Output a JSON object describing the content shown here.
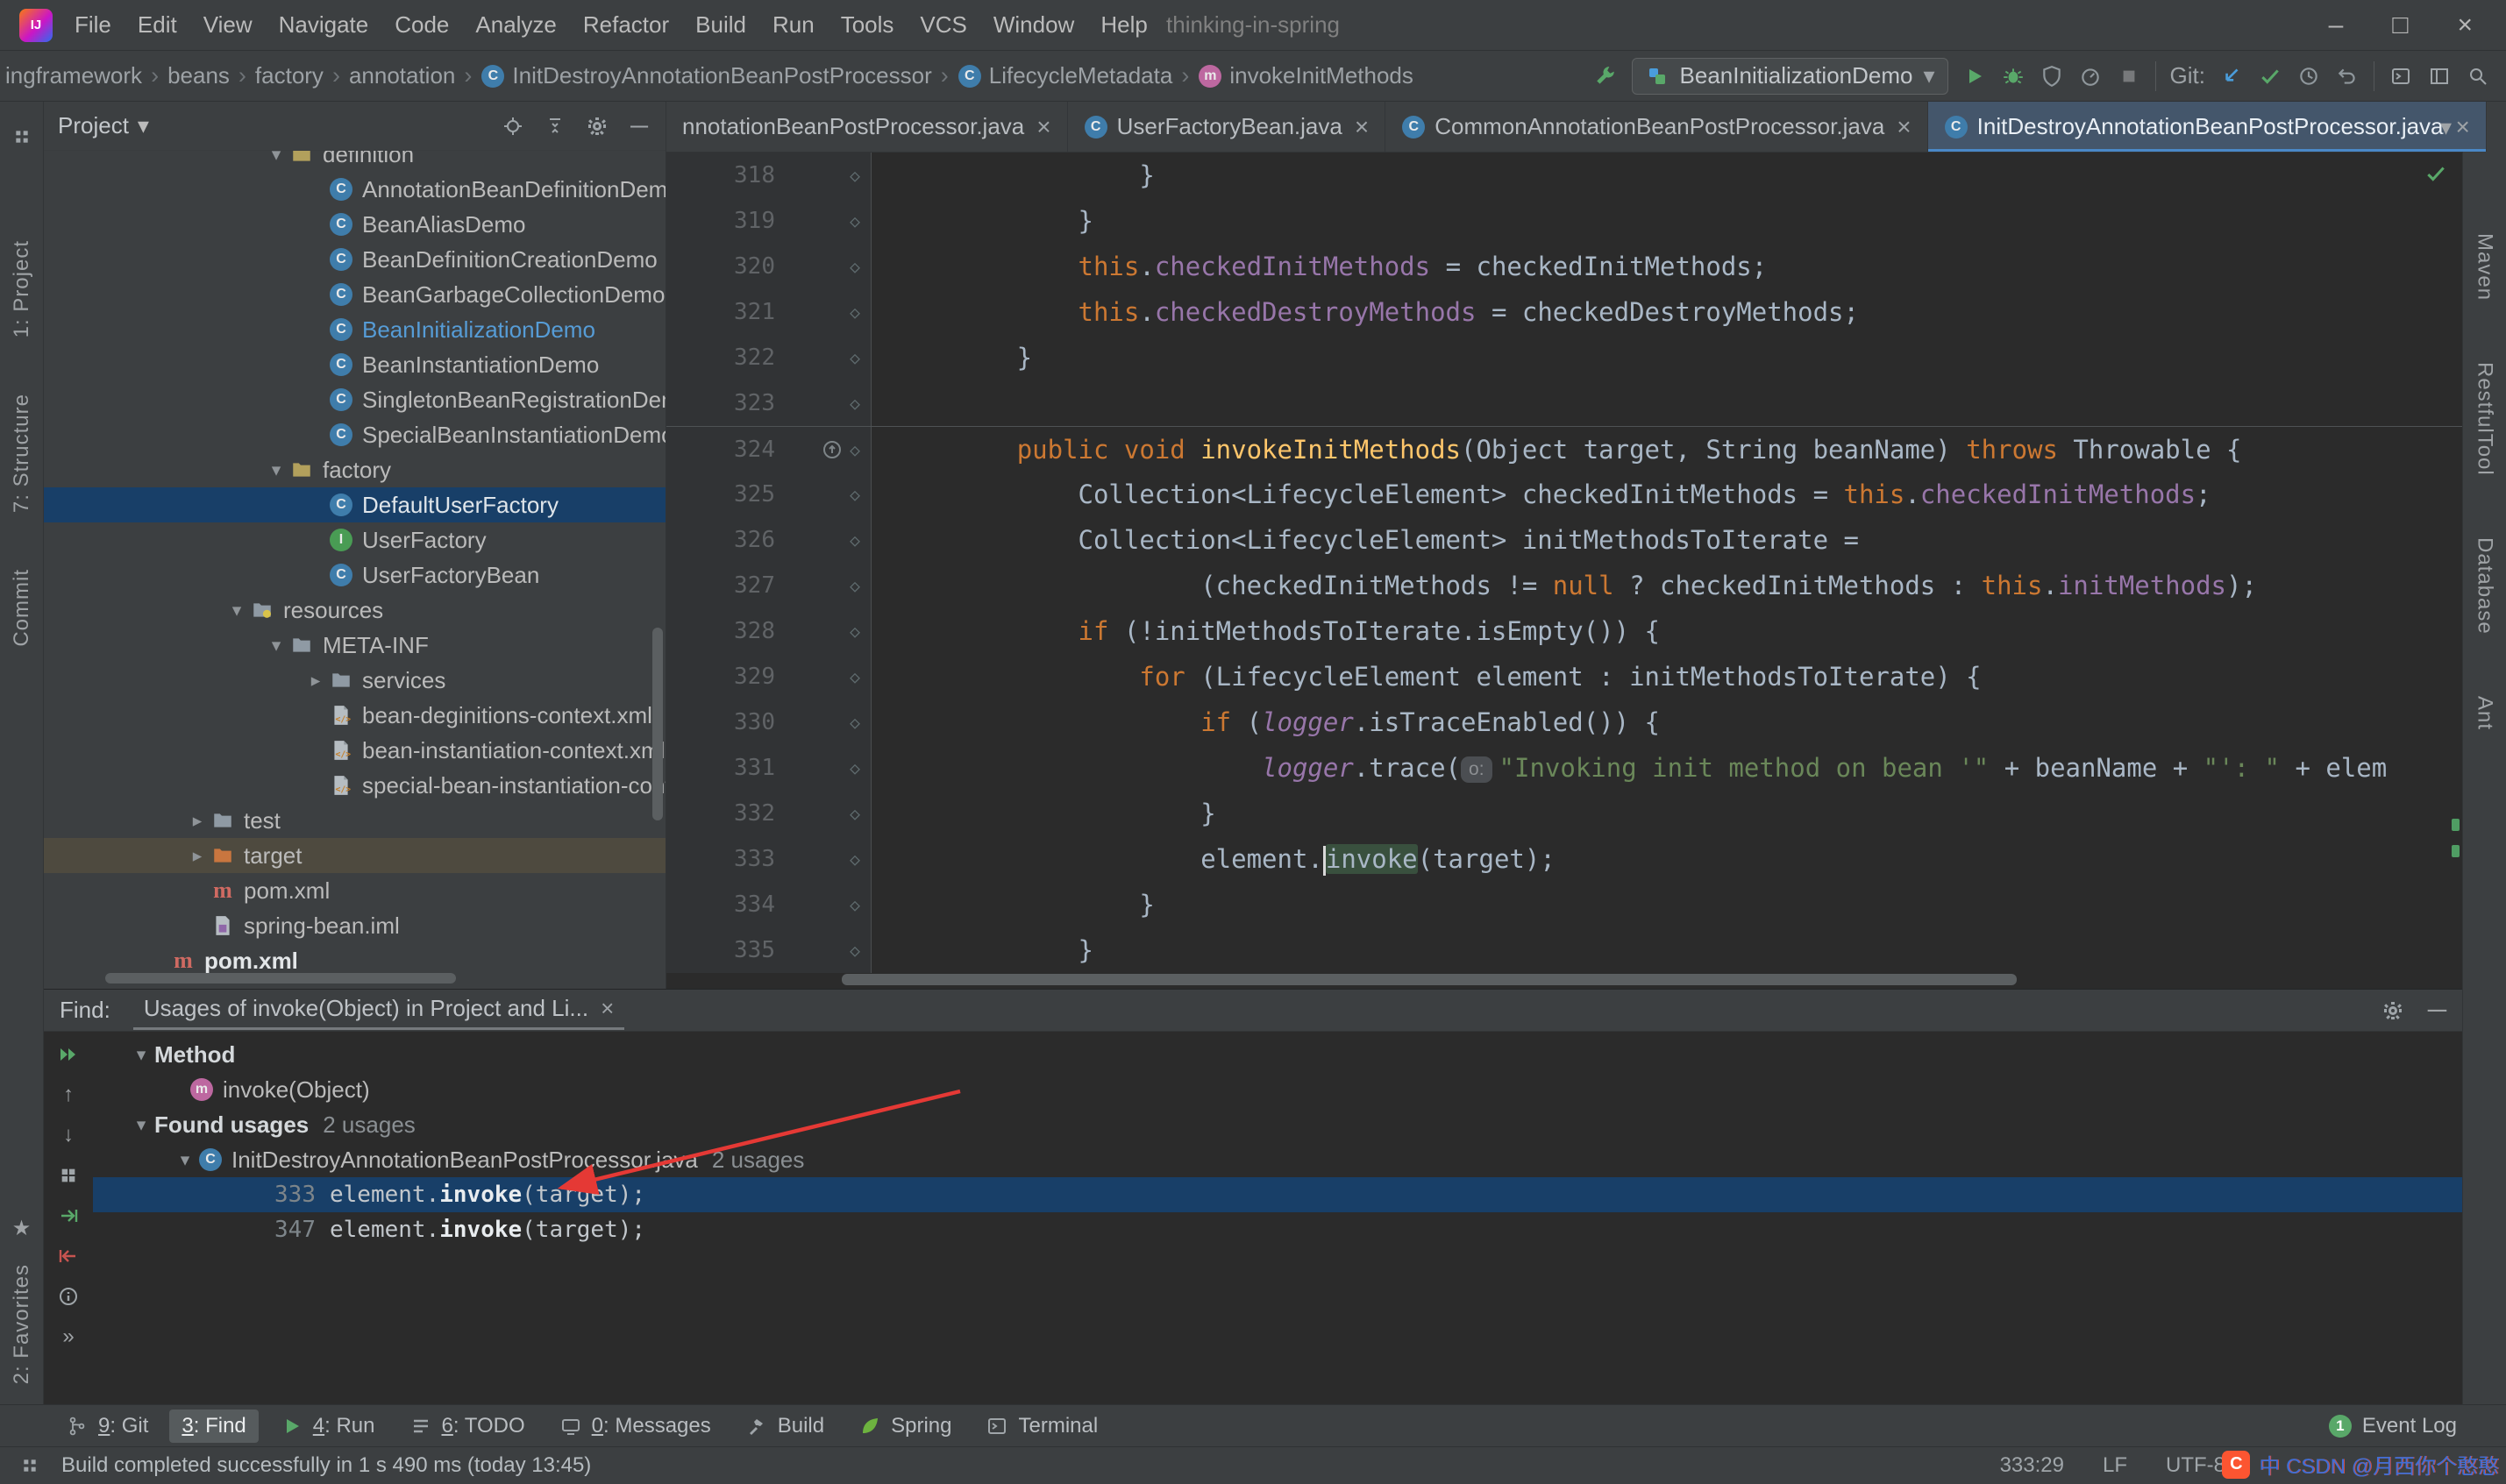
{
  "menu_bar": {
    "menus": [
      "File",
      "Edit",
      "View",
      "Navigate",
      "Code",
      "Analyze",
      "Refactor",
      "Build",
      "Run",
      "Tools",
      "VCS",
      "Window",
      "Help"
    ],
    "title": "thinking-in-spring",
    "window_controls": {
      "minimize": "–",
      "maximize": "□",
      "close": "×"
    }
  },
  "nav_bar": {
    "breadcrumbs": [
      {
        "label": "ingframework"
      },
      {
        "label": "beans"
      },
      {
        "label": "factory"
      },
      {
        "label": "annotation"
      },
      {
        "label": "InitDestroyAnnotationBeanPostProcessor",
        "icon": "class"
      },
      {
        "label": "LifecycleMetadata",
        "icon": "class"
      },
      {
        "label": "invokeInitMethods",
        "icon": "method"
      }
    ],
    "pre_combo_icons": [
      "wrench"
    ],
    "run_config": "BeanInitializationDemo",
    "run_icons": [
      "play",
      "bug",
      "shield",
      "gauge",
      "stop"
    ],
    "git_label": "Git:",
    "git_icons": [
      "update",
      "commit",
      "history",
      "undo"
    ],
    "far_icons": [
      "console",
      "layout",
      "search"
    ]
  },
  "left_stripe": {
    "top": [
      "1: Project",
      "7: Structure",
      "Commit"
    ],
    "bottom": [
      "2: Favorites"
    ]
  },
  "right_stripe": [
    "Maven",
    "RestfulTool",
    "Database",
    "Ant"
  ],
  "project_panel": {
    "title": "Project",
    "header_icons": [
      "locate",
      "collapse",
      "gear",
      "hide"
    ],
    "tree": [
      {
        "label": "definition",
        "icon": "package",
        "indent": 4,
        "chevron": "down"
      },
      {
        "label": "AnnotationBeanDefinitionDemo",
        "icon": "class",
        "indent": 5
      },
      {
        "label": "BeanAliasDemo",
        "icon": "class",
        "indent": 5
      },
      {
        "label": "BeanDefinitionCreationDemo",
        "icon": "class",
        "indent": 5
      },
      {
        "label": "BeanGarbageCollectionDemo",
        "icon": "class",
        "indent": 5
      },
      {
        "label": "BeanInitializationDemo",
        "icon": "class",
        "indent": 5,
        "highlight_text": true
      },
      {
        "label": "BeanInstantiationDemo",
        "icon": "class",
        "indent": 5
      },
      {
        "label": "SingletonBeanRegistrationDemo",
        "icon": "class",
        "indent": 5
      },
      {
        "label": "SpecialBeanInstantiationDemo",
        "icon": "class",
        "indent": 5
      },
      {
        "label": "factory",
        "icon": "package",
        "indent": 4,
        "chevron": "down"
      },
      {
        "label": "DefaultUserFactory",
        "icon": "class",
        "indent": 5,
        "selected": true
      },
      {
        "label": "UserFactory",
        "icon": "interface",
        "indent": 5
      },
      {
        "label": "UserFactoryBean",
        "icon": "class",
        "indent": 5
      },
      {
        "label": "resources",
        "icon": "folder-resources",
        "indent": 3,
        "chevron": "down"
      },
      {
        "label": "META-INF",
        "icon": "folder",
        "indent": 4,
        "chevron": "down"
      },
      {
        "label": "services",
        "icon": "folder",
        "indent": 5,
        "chevron": "right"
      },
      {
        "label": "bean-deginitions-context.xml",
        "icon": "xml",
        "indent": 5
      },
      {
        "label": "bean-instantiation-context.xml",
        "icon": "xml",
        "indent": 5
      },
      {
        "label": "special-bean-instantiation-context.xml",
        "icon": "xml",
        "indent": 5
      },
      {
        "label": "test",
        "icon": "folder",
        "indent": 2,
        "chevron": "right"
      },
      {
        "label": "target",
        "icon": "folder-excluded",
        "indent": 2,
        "chevron": "right",
        "row_highlight": true
      },
      {
        "label": "pom.xml",
        "icon": "maven",
        "indent": 2
      },
      {
        "label": "spring-bean.iml",
        "icon": "iml",
        "indent": 2
      },
      {
        "label": "pom.xml",
        "icon": "maven",
        "indent": 1,
        "bold": true
      }
    ]
  },
  "editor": {
    "tabs": [
      {
        "label": "nnotationBeanPostProcessor.java"
      },
      {
        "label": "UserFactoryBean.java",
        "icon": "class"
      },
      {
        "label": "CommonAnnotationBeanPostProcessor.java",
        "icon": "class"
      },
      {
        "label": "InitDestroyAnnotationBeanPostProcessor.java",
        "icon": "class",
        "active": true
      }
    ],
    "lines": [
      {
        "num": "318",
        "segs": [
          [
            "                }",
            "d"
          ]
        ]
      },
      {
        "num": "319",
        "segs": [
          [
            "            }",
            "d"
          ]
        ]
      },
      {
        "num": "320",
        "segs": [
          [
            "            ",
            "d"
          ],
          [
            "this",
            "k"
          ],
          [
            ".",
            "d"
          ],
          [
            "checkedInitMethods",
            "f"
          ],
          [
            " = checkedInitMethods;",
            "d"
          ]
        ]
      },
      {
        "num": "321",
        "segs": [
          [
            "            ",
            "d"
          ],
          [
            "this",
            "k"
          ],
          [
            ".",
            "d"
          ],
          [
            "checkedDestroyMethods",
            "f"
          ],
          [
            " = checkedDestroyMethods;",
            "d"
          ]
        ]
      },
      {
        "num": "322",
        "segs": [
          [
            "        }",
            "d"
          ]
        ]
      },
      {
        "num": "323",
        "segs": []
      },
      {
        "num": "324",
        "separator": true,
        "gutter_icon": "override",
        "segs": [
          [
            "        ",
            "d"
          ],
          [
            "public void ",
            "k"
          ],
          [
            "invokeInitMethods",
            "m"
          ],
          [
            "(Object target, String beanName) ",
            "d"
          ],
          [
            "throws",
            "k"
          ],
          [
            " Throwable {",
            "d"
          ]
        ]
      },
      {
        "num": "325",
        "segs": [
          [
            "            Collection<LifecycleElement> checkedInitMethods = ",
            "d"
          ],
          [
            "this",
            "k"
          ],
          [
            ".",
            "d"
          ],
          [
            "checkedInitMethods",
            "f"
          ],
          [
            ";",
            "d"
          ]
        ]
      },
      {
        "num": "326",
        "segs": [
          [
            "            Collection<LifecycleElement> initMethodsToIterate =",
            "d"
          ]
        ]
      },
      {
        "num": "327",
        "segs": [
          [
            "                    (checkedInitMethods != ",
            "d"
          ],
          [
            "null",
            "k"
          ],
          [
            " ? checkedInitMethods : ",
            "d"
          ],
          [
            "this",
            "k"
          ],
          [
            ".",
            "d"
          ],
          [
            "initMethods",
            "f"
          ],
          [
            ");",
            "d"
          ]
        ]
      },
      {
        "num": "328",
        "segs": [
          [
            "            ",
            "d"
          ],
          [
            "if",
            "k"
          ],
          [
            " (!initMethodsToIterate.isEmpty()) {",
            "d"
          ]
        ]
      },
      {
        "num": "329",
        "segs": [
          [
            "                ",
            "d"
          ],
          [
            "for",
            "k"
          ],
          [
            " (LifecycleElement element : initMethodsToIterate) {",
            "d"
          ]
        ]
      },
      {
        "num": "330",
        "segs": [
          [
            "                    ",
            "d"
          ],
          [
            "if",
            "k"
          ],
          [
            " (",
            "d"
          ],
          [
            "logger",
            "fi"
          ],
          [
            ".isTraceEnabled()) {",
            "d"
          ]
        ]
      },
      {
        "num": "331",
        "segs": [
          [
            "                        ",
            "d"
          ],
          [
            "logger",
            "fi"
          ],
          [
            ".trace(",
            "d"
          ],
          [
            "o:",
            "h"
          ],
          [
            "\"Invoking init method on bean '\"",
            "s"
          ],
          [
            " + beanName + ",
            "d"
          ],
          [
            "\"': \"",
            "s"
          ],
          [
            " + elem",
            "d"
          ]
        ]
      },
      {
        "num": "332",
        "segs": [
          [
            "                    }",
            "d"
          ]
        ]
      },
      {
        "num": "333",
        "segs": [
          [
            "                    element.",
            "d"
          ],
          [
            "",
            "caret"
          ],
          [
            "invoke",
            "hl"
          ],
          [
            "(target);",
            "d"
          ]
        ]
      },
      {
        "num": "334",
        "segs": [
          [
            "                }",
            "d"
          ]
        ]
      },
      {
        "num": "335",
        "segs": [
          [
            "            }",
            "d"
          ]
        ]
      }
    ]
  },
  "find_panel": {
    "label": "Find:",
    "tab": "Usages of invoke(Object) in Project and Li...",
    "tool_icons": [
      "rerun",
      "up",
      "down",
      "group4",
      "navgreen",
      "navred",
      "info",
      "more"
    ],
    "rows": [
      {
        "type": "group",
        "chevron": "down",
        "label": "Method",
        "bold": true
      },
      {
        "type": "item",
        "icon": "method",
        "label": "invoke(Object)"
      },
      {
        "type": "group",
        "chevron": "down",
        "label": "Found usages",
        "bold": true,
        "suffix": "2 usages"
      },
      {
        "type": "file",
        "chevron": "down",
        "icon": "class",
        "label": "InitDestroyAnnotationBeanPostProcessor.java",
        "suffix": "2 usages"
      },
      {
        "type": "usage",
        "line": "333",
        "code_pre": "element.",
        "code_match": "invoke",
        "code_post": "(target);",
        "selected": true
      },
      {
        "type": "usage",
        "line": "347",
        "code_pre": "element.",
        "code_match": "invoke",
        "code_post": "(target);"
      }
    ]
  },
  "bottom_bar": {
    "items": [
      {
        "label": "9: Git",
        "icon": "branch"
      },
      {
        "label": "3: Find",
        "active": true
      },
      {
        "label": "4: Run",
        "icon": "play"
      },
      {
        "label": "6: TODO",
        "icon": "todo"
      },
      {
        "label": "0: Messages",
        "icon": "messages"
      },
      {
        "label": "Build",
        "icon": "hammer"
      },
      {
        "label": "Spring",
        "icon": "leaf"
      },
      {
        "label": "Terminal",
        "icon": "console"
      }
    ],
    "event_log": {
      "label": "Event Log",
      "badge": "1"
    }
  },
  "status_bar": {
    "message": "Build completed successfully in 1 s 490 ms (today 13:45)",
    "position": "333:29",
    "line_ending": "LF",
    "encoding": "UTF-8",
    "watermark": "中 CSDN @月西你个憨憨"
  }
}
